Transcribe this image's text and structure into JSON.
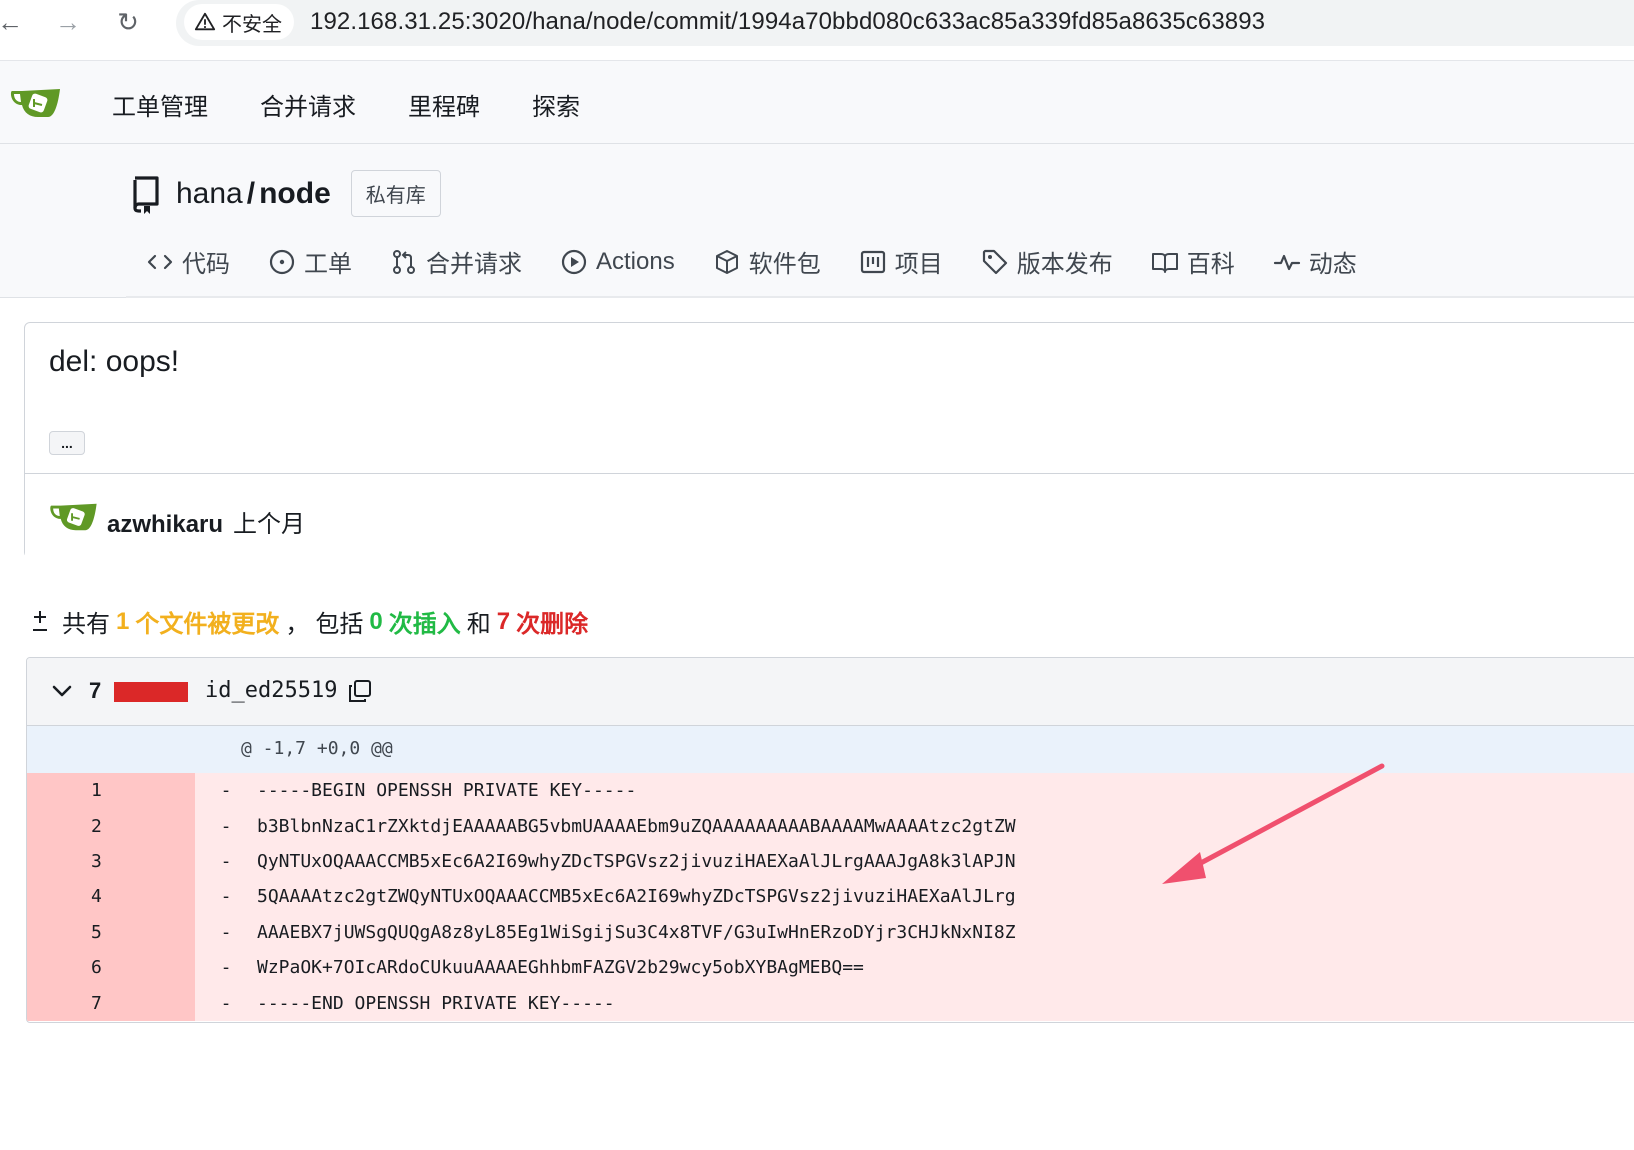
{
  "browser": {
    "back_glyph": "←",
    "forward_glyph": "→",
    "reload_glyph": "↻",
    "security_label": "不安全",
    "url": "192.168.31.25:3020/hana/node/commit/1994a70bbd080c633ac85a339fd85a8635c63893"
  },
  "header": {
    "nav": [
      "工单管理",
      "合并请求",
      "里程碑",
      "探索"
    ]
  },
  "repo": {
    "owner": "hana",
    "separator": "/",
    "name": "node",
    "badge": "私有库",
    "tabs": [
      {
        "label": "代码",
        "icon": "code-icon"
      },
      {
        "label": "工单",
        "icon": "issue-icon"
      },
      {
        "label": "合并请求",
        "icon": "pull-request-icon"
      },
      {
        "label": "Actions",
        "icon": "play-icon"
      },
      {
        "label": "软件包",
        "icon": "package-icon"
      },
      {
        "label": "项目",
        "icon": "project-icon"
      },
      {
        "label": "版本发布",
        "icon": "tag-icon"
      },
      {
        "label": "百科",
        "icon": "book-icon"
      },
      {
        "label": "动态",
        "icon": "pulse-icon"
      }
    ]
  },
  "commit": {
    "title": "del: oops!",
    "ellipsis": "...",
    "author": "azwhikaru",
    "time": "上个月"
  },
  "stats": {
    "prefix": "共有",
    "files_count": "1",
    "files_label": "个文件被更改",
    "comma": "，",
    "including": "包括",
    "insertions_count": "0",
    "insertions_label": "次插入",
    "and": "和",
    "deletions_count": "7",
    "deletions_label": "次删除"
  },
  "diff": {
    "deletions": "7",
    "file_name": "id_ed25519",
    "hunk_header": "@ -1,7 +0,0 @@",
    "lines": [
      {
        "num": "1",
        "sign": "-",
        "code": "-----BEGIN OPENSSH PRIVATE KEY-----"
      },
      {
        "num": "2",
        "sign": "-",
        "code": "b3BlbnNzaC1rZXktdjEAAAAABG5vbmUAAAAEbm9uZQAAAAAAAAABAAAAMwAAAAtzc2gtZW"
      },
      {
        "num": "3",
        "sign": "-",
        "code": "QyNTUxOQAAACCMB5xEc6A2I69whyZDcTSPGVsz2jivuziHAEXaAlJLrgAAAJgA8k3lAPJN"
      },
      {
        "num": "4",
        "sign": "-",
        "code": "5QAAAAtzc2gtZWQyNTUxOQAAACCMB5xEc6A2I69whyZDcTSPGVsz2jivuziHAEXaAlJLrg"
      },
      {
        "num": "5",
        "sign": "-",
        "code": "AAAEBX7jUWSgQUQgA8z8yL85Eg1WiSgijSu3C4x8TVF/G3uIwHnERzoDYjr3CHJkNxNI8Z"
      },
      {
        "num": "6",
        "sign": "-",
        "code": "WzPaOK+7OIcARdoCUkuuAAAAEGhhbmFAZGV2b29wcy5obXYBAgMEBQ=="
      },
      {
        "num": "7",
        "sign": "-",
        "code": "-----END OPENSSH PRIVATE KEY-----"
      }
    ]
  },
  "colors": {
    "annotation_arrow": "#f0506e",
    "deleted_row": "#ffe9ea",
    "deleted_gutter": "#ffc6c6",
    "hunk_bg": "#eaf2fb",
    "logo_green": "#609926"
  }
}
